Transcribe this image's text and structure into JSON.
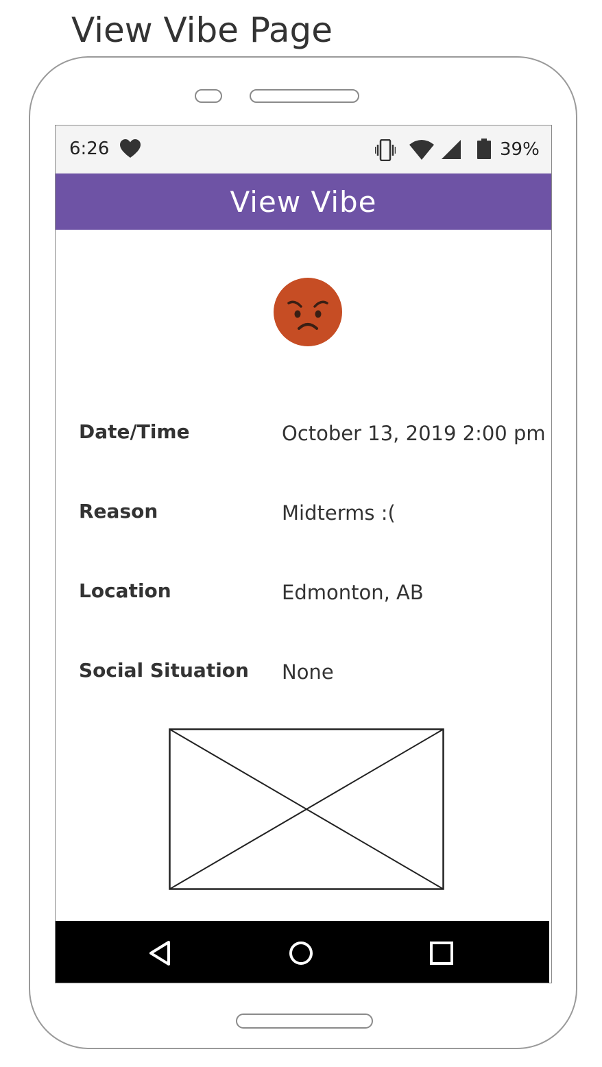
{
  "page_title": "View Vibe Page",
  "status_bar": {
    "time": "6:26",
    "battery": "39%",
    "icons": [
      "heart-icon",
      "vibrate-icon",
      "wifi-icon",
      "signal-icon",
      "battery-icon"
    ]
  },
  "app_bar": {
    "title": "View Vibe",
    "color": "#6e53a5"
  },
  "mood": {
    "emoji": "angry-face-icon",
    "color": "#c64d24"
  },
  "details": [
    {
      "label": "Date/Time",
      "value": "October 13, 2019  2:00 pm"
    },
    {
      "label": "Reason",
      "value": "Midterms :("
    },
    {
      "label": "Location",
      "value": "Edmonton, AB"
    },
    {
      "label": "Social Situation",
      "value": "None"
    }
  ],
  "nav_bar": {
    "buttons": [
      "back-icon",
      "home-icon",
      "recents-icon"
    ]
  }
}
